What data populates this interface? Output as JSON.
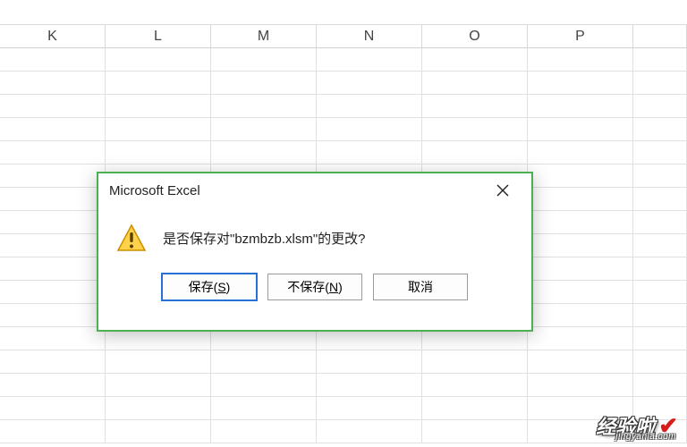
{
  "spreadsheet": {
    "columns": [
      "K",
      "L",
      "M",
      "N",
      "O",
      "P"
    ]
  },
  "dialog": {
    "title": "Microsoft Excel",
    "message": "是否保存对\"bzmbzb.xlsm\"的更改?",
    "buttons": {
      "save": "保存(S)",
      "dont_save": "不保存(N)",
      "cancel": "取消"
    }
  },
  "watermark": {
    "text": "经验啦",
    "url": "jingyanla.com"
  }
}
